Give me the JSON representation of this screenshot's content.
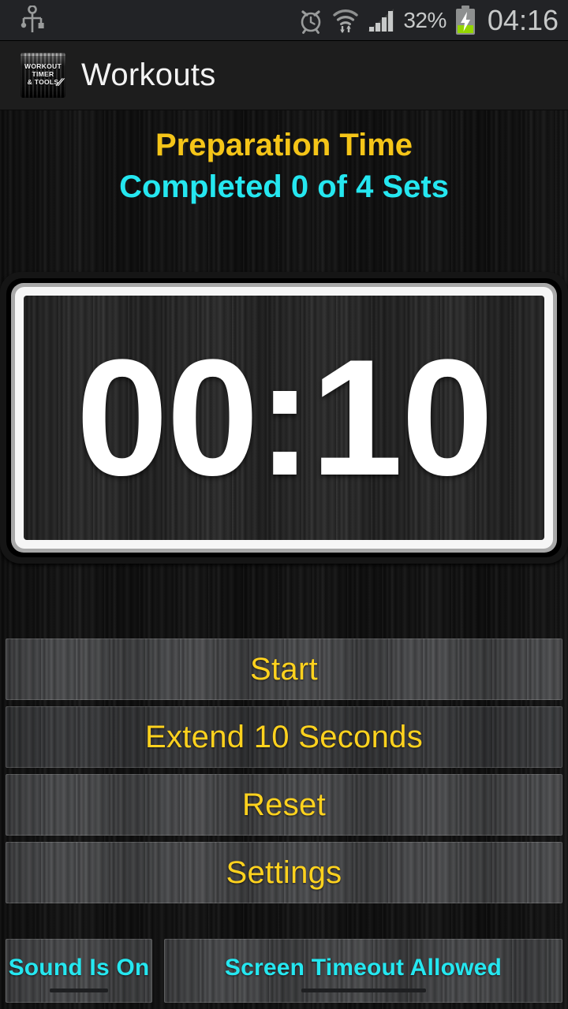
{
  "statusbar": {
    "usb_icon": "usb-icon",
    "alarm_icon": "alarm-clock-icon",
    "wifi_icon": "wifi-transfer-icon",
    "signal_icon": "cellular-signal-icon",
    "battery_percent": "32%",
    "battery_icon": "battery-charging-icon",
    "clock": "04:16"
  },
  "actionbar": {
    "app_icon": "workout-timer-tools-app-icon",
    "app_icon_line1": "WORKOUT",
    "app_icon_line2": "TIMER",
    "app_icon_line3": "& TOOLS",
    "title": "Workouts"
  },
  "main": {
    "heading": "Preparation Time",
    "subheading": "Completed 0 of 4 Sets",
    "timer_value": "00:10"
  },
  "buttons": [
    {
      "name": "start-button",
      "label": "Start",
      "style": "light"
    },
    {
      "name": "extend-10-seconds-button",
      "label": "Extend 10 Seconds",
      "style": "dim"
    },
    {
      "name": "reset-button",
      "label": "Reset",
      "style": "light"
    },
    {
      "name": "settings-button",
      "label": "Settings",
      "style": "light"
    }
  ],
  "toggles": {
    "sound": "Sound Is On",
    "screen_timeout": "Screen Timeout Allowed"
  },
  "colors": {
    "gold_heading": "#f5c518",
    "gold_button": "#ffd21e",
    "cyan": "#25e7f0",
    "background": "#111111",
    "button_light": "#4c4d4f",
    "button_dim": "#3b3c3e",
    "status_bar": "#222326",
    "action_bar": "#1d1d1d"
  }
}
